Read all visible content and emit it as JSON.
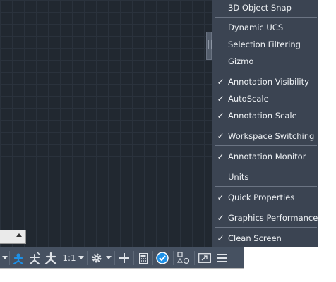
{
  "customize_menu": {
    "items": [
      {
        "label": "3D Object Snap",
        "checked": false
      },
      {
        "label": "Dynamic UCS",
        "checked": false
      },
      {
        "label": "Selection Filtering",
        "checked": false
      },
      {
        "label": "Gizmo",
        "checked": false
      },
      {
        "label": "Annotation Visibility",
        "checked": true
      },
      {
        "label": "AutoScale",
        "checked": true
      },
      {
        "label": "Annotation Scale",
        "checked": true
      },
      {
        "label": "Workspace Switching",
        "checked": true
      },
      {
        "label": "Annotation Monitor",
        "checked": true
      },
      {
        "label": "Units",
        "checked": false
      },
      {
        "label": "Quick Properties",
        "checked": true
      },
      {
        "label": "Graphics Performance",
        "checked": true
      },
      {
        "label": "Clean Screen",
        "checked": true
      }
    ],
    "check_glyph": "✓"
  },
  "status_bar": {
    "annotation_scale": "1:1",
    "icons": [
      "annotation-visibility-icon",
      "autoscale-icon",
      "annotation-monitor-icon",
      "gear-icon",
      "plus-icon",
      "calculator-icon",
      "isolate-objects-icon",
      "hardware-acceleration-icon",
      "fullscreen-icon",
      "menu-icon"
    ]
  },
  "colors": {
    "drawing_background": "#212830",
    "status_bar": "#465161",
    "menu_background": "#3b4452",
    "accent_blue": "#1e90e6"
  }
}
